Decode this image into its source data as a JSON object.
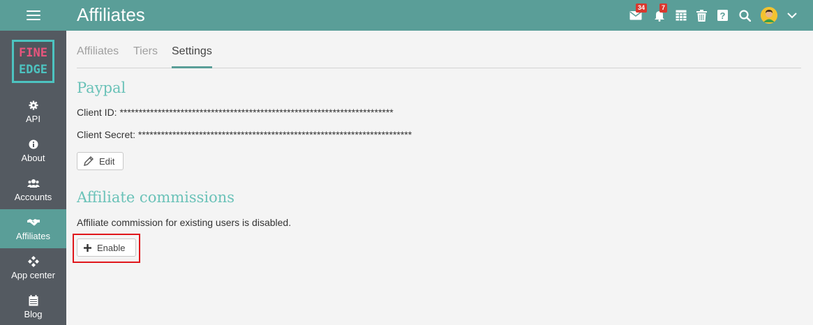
{
  "header": {
    "title": "Affiliates",
    "mail_count": "34",
    "notif_count": "7"
  },
  "logo": {
    "line1": "FINE",
    "line2": "EDGE"
  },
  "sidebar": {
    "items": [
      {
        "label": "API",
        "icon": "gear-icon"
      },
      {
        "label": "About",
        "icon": "info-icon"
      },
      {
        "label": "Accounts",
        "icon": "users-icon"
      },
      {
        "label": "Affiliates",
        "icon": "handshake-icon"
      },
      {
        "label": "App center",
        "icon": "diamond-grid-icon"
      },
      {
        "label": "Blog",
        "icon": "calendar-icon"
      }
    ]
  },
  "tabs": [
    "Affiliates",
    "Tiers",
    "Settings"
  ],
  "paypal": {
    "heading": "Paypal",
    "client_id": "Client ID: ************************************************************************",
    "client_secret": "Client Secret: ************************************************************************",
    "edit_label": "Edit"
  },
  "commissions": {
    "heading": "Affiliate commissions",
    "status_text": "Affiliate commission for existing users is disabled.",
    "enable_label": "Enable"
  },
  "colors": {
    "accent": "#5a9e98",
    "sidebar": "#545a61",
    "heading": "#6ac2b8",
    "highlight": "#e0161b"
  }
}
